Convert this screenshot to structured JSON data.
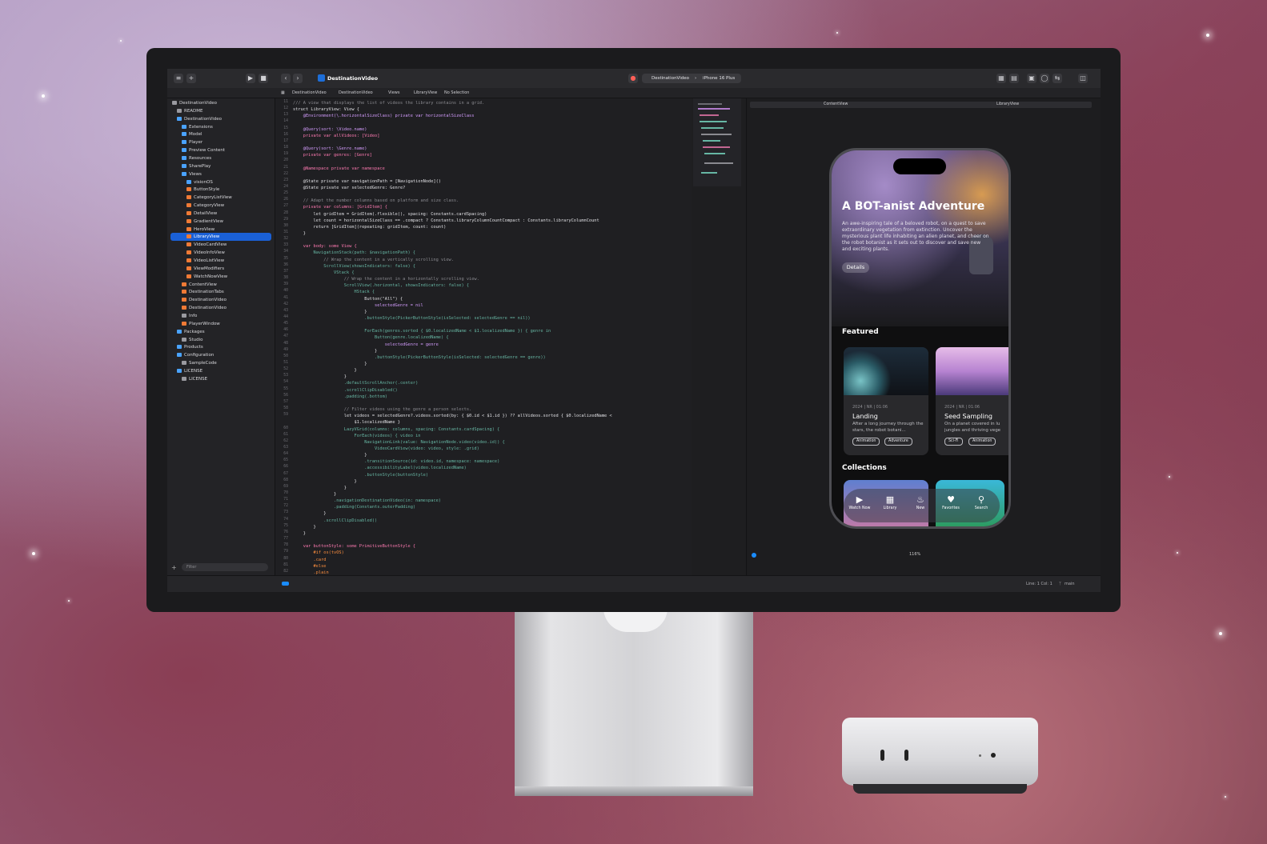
{
  "toolbar": {
    "project_title": "DestinationVideo",
    "scheme_target": "DestinationVideo",
    "scheme_device": "iPhone 16 Plus"
  },
  "jumpbar": {
    "crumbs": [
      "DestinationVideo",
      "DestinationVideo",
      "Views",
      "LibraryView",
      "No Selection"
    ]
  },
  "navigator": {
    "items": [
      {
        "label": "DestinationVideo",
        "icon": "doc",
        "indent": 1
      },
      {
        "label": "README",
        "icon": "doc",
        "indent": 2
      },
      {
        "label": "DestinationVideo",
        "icon": "folder",
        "indent": 2
      },
      {
        "label": "Extensions",
        "icon": "folder",
        "indent": 3
      },
      {
        "label": "Model",
        "icon": "folder",
        "indent": 3
      },
      {
        "label": "Player",
        "icon": "folder",
        "indent": 3
      },
      {
        "label": "Preview Content",
        "icon": "folder",
        "indent": 3
      },
      {
        "label": "Resources",
        "icon": "folder",
        "indent": 3
      },
      {
        "label": "SharePlay",
        "icon": "folder",
        "indent": 3
      },
      {
        "label": "Views",
        "icon": "folder",
        "indent": 3
      },
      {
        "label": "visionOS",
        "icon": "folder",
        "indent": 4
      },
      {
        "label": "ButtonStyle",
        "icon": "swift",
        "indent": 4
      },
      {
        "label": "CategoryListView",
        "icon": "swift",
        "indent": 4
      },
      {
        "label": "CategoryView",
        "icon": "swift",
        "indent": 4
      },
      {
        "label": "DetailView",
        "icon": "swift",
        "indent": 4
      },
      {
        "label": "GradientView",
        "icon": "swift",
        "indent": 4
      },
      {
        "label": "HeroView",
        "icon": "swift",
        "indent": 4
      },
      {
        "label": "LibraryView",
        "icon": "swift",
        "indent": 4,
        "selected": true
      },
      {
        "label": "VideoCardView",
        "icon": "swift",
        "indent": 4
      },
      {
        "label": "VideoInfoView",
        "icon": "swift",
        "indent": 4
      },
      {
        "label": "VideoListView",
        "icon": "swift",
        "indent": 4
      },
      {
        "label": "ViewModifiers",
        "icon": "swift",
        "indent": 4
      },
      {
        "label": "WatchNowView",
        "icon": "swift",
        "indent": 4
      },
      {
        "label": "ContentView",
        "icon": "swift",
        "indent": 3
      },
      {
        "label": "DestinationTabs",
        "icon": "swift",
        "indent": 3
      },
      {
        "label": "DestinationVideo",
        "icon": "swift",
        "indent": 3
      },
      {
        "label": "DestinationVideo",
        "icon": "swift",
        "indent": 3
      },
      {
        "label": "Info",
        "icon": "doc",
        "indent": 3
      },
      {
        "label": "PlayerWindow",
        "icon": "swift",
        "indent": 3
      },
      {
        "label": "Packages",
        "icon": "folder",
        "indent": 2
      },
      {
        "label": "Studio",
        "icon": "doc",
        "indent": 3
      },
      {
        "label": "Products",
        "icon": "folder",
        "indent": 2
      },
      {
        "label": "Configuration",
        "icon": "folder",
        "indent": 2
      },
      {
        "label": "SampleCode",
        "icon": "doc",
        "indent": 3
      },
      {
        "label": "LICENSE",
        "icon": "folder",
        "indent": 2
      },
      {
        "label": "LICENSE",
        "icon": "doc",
        "indent": 3
      }
    ],
    "filter_placeholder": "Filter"
  },
  "editor": {
    "lines": [
      {
        "n": "11",
        "t": "/// A view that displays the list of videos the library contains in a grid.",
        "c": "#8b8b91"
      },
      {
        "n": "12",
        "t": "struct LibraryView: View {",
        "c": "#e0e0e4"
      },
      {
        "n": "13",
        "t": "    @Environment(\\.horizontalSizeClass) private var horizontalSizeClass",
        "c": "#d59dff"
      },
      {
        "n": "14",
        "t": "",
        "c": "#e0e0e4"
      },
      {
        "n": "15",
        "t": "    @Query(sort: \\Video.name)",
        "c": "#d59dff"
      },
      {
        "n": "16",
        "t": "    private var allVideos: [Video]",
        "c": "#ff7ab2"
      },
      {
        "n": "17",
        "t": "",
        "c": "#e0e0e4"
      },
      {
        "n": "18",
        "t": "    @Query(sort: \\Genre.name)",
        "c": "#d59dff"
      },
      {
        "n": "19",
        "t": "    private var genres: [Genre]",
        "c": "#ff7ab2"
      },
      {
        "n": "20",
        "t": "",
        "c": "#e0e0e4"
      },
      {
        "n": "21",
        "t": "    @Namespace private var namespace",
        "c": "#ff7ab2"
      },
      {
        "n": "22",
        "t": "",
        "c": "#e0e0e4"
      },
      {
        "n": "23",
        "t": "    @State private var navigationPath = [NavigationNode]()",
        "c": "#e0e0e4"
      },
      {
        "n": "24",
        "t": "    @State private var selectedGenre: Genre?",
        "c": "#e0e0e4"
      },
      {
        "n": "25",
        "t": "",
        "c": "#e0e0e4"
      },
      {
        "n": "26",
        "t": "    // Adapt the number columns based on platform and size class.",
        "c": "#8b8b91"
      },
      {
        "n": "27",
        "t": "    private var columns: [GridItem] {",
        "c": "#ff7ab2"
      },
      {
        "n": "28",
        "t": "        let gridItem = GridItem(.flexible(), spacing: Constants.cardSpacing)",
        "c": "#e0e0e4"
      },
      {
        "n": "29",
        "t": "        let count = horizontalSizeClass == .compact ? Constants.libraryColumnCountCompact : Constants.libraryColumnCount",
        "c": "#e0e0e4"
      },
      {
        "n": "30",
        "t": "        return [GridItem](repeating: gridItem, count: count)",
        "c": "#e0e0e4"
      },
      {
        "n": "31",
        "t": "    }",
        "c": "#e0e0e4"
      },
      {
        "n": "32",
        "t": "",
        "c": "#e0e0e4"
      },
      {
        "n": "33",
        "t": "    var body: some View {",
        "c": "#ff7ab2"
      },
      {
        "n": "34",
        "t": "        NavigationStack(path: $navigationPath) {",
        "c": "#67b7a4"
      },
      {
        "n": "35",
        "t": "            // Wrap the content in a vertically scrolling view.",
        "c": "#8b8b91"
      },
      {
        "n": "36",
        "t": "            ScrollView(showsIndicators: false) {",
        "c": "#67b7a4"
      },
      {
        "n": "37",
        "t": "                VStack {",
        "c": "#67b7a4"
      },
      {
        "n": "38",
        "t": "                    // Wrap the content in a horizontally scrolling view.",
        "c": "#8b8b91"
      },
      {
        "n": "39",
        "t": "                    ScrollView(.horizontal, showsIndicators: false) {",
        "c": "#67b7a4"
      },
      {
        "n": "40",
        "t": "                        HStack {",
        "c": "#67b7a4"
      },
      {
        "n": "41",
        "t": "                            Button(\"All\") {",
        "c": "#e0e0e4"
      },
      {
        "n": "42",
        "t": "                                selectedGenre = nil",
        "c": "#d59dff"
      },
      {
        "n": "43",
        "t": "                            }",
        "c": "#e0e0e4"
      },
      {
        "n": "44",
        "t": "                            .buttonStyle(PickerButtonStyle(isSelected: selectedGenre == nil))",
        "c": "#67b7a4"
      },
      {
        "n": "45",
        "t": "",
        "c": "#e0e0e4"
      },
      {
        "n": "46",
        "t": "                            ForEach(genres.sorted { $0.localizedName < $1.localizedName }) { genre in",
        "c": "#67b7a4"
      },
      {
        "n": "47",
        "t": "                                Button(genre.localizedName) {",
        "c": "#67b7a4"
      },
      {
        "n": "48",
        "t": "                                    selectedGenre = genre",
        "c": "#d59dff"
      },
      {
        "n": "49",
        "t": "                                }",
        "c": "#e0e0e4"
      },
      {
        "n": "50",
        "t": "                                .buttonStyle(PickerButtonStyle(isSelected: selectedGenre == genre))",
        "c": "#67b7a4"
      },
      {
        "n": "51",
        "t": "                            }",
        "c": "#e0e0e4"
      },
      {
        "n": "52",
        "t": "                        }",
        "c": "#e0e0e4"
      },
      {
        "n": "53",
        "t": "                    }",
        "c": "#e0e0e4"
      },
      {
        "n": "54",
        "t": "                    .defaultScrollAnchor(.center)",
        "c": "#67b7a4"
      },
      {
        "n": "55",
        "t": "                    .scrollClipDisabled()",
        "c": "#67b7a4"
      },
      {
        "n": "56",
        "t": "                    .padding(.bottom)",
        "c": "#67b7a4"
      },
      {
        "n": "57",
        "t": "",
        "c": "#e0e0e4"
      },
      {
        "n": "58",
        "t": "                    // Filter videos using the genre a person selects.",
        "c": "#8b8b91"
      },
      {
        "n": "59",
        "t": "                    let videos = selectedGenre?.videos.sorted(by: { $0.id < $1.id }) ?? allVideos.sorted { $0.localizedName <",
        "c": "#e0e0e4"
      },
      {
        "n": "",
        "t": "                        $1.localizedName }",
        "c": "#e0e0e4"
      },
      {
        "n": "60",
        "t": "                    LazyVGrid(columns: columns, spacing: Constants.cardSpacing) {",
        "c": "#67b7a4"
      },
      {
        "n": "61",
        "t": "                        ForEach(videos) { video in",
        "c": "#67b7a4"
      },
      {
        "n": "62",
        "t": "                            NavigationLink(value: NavigationNode.video(video.id)) {",
        "c": "#67b7a4"
      },
      {
        "n": "63",
        "t": "                                VideoCardView(video: video, style: .grid)",
        "c": "#67b7a4"
      },
      {
        "n": "64",
        "t": "                            }",
        "c": "#e0e0e4"
      },
      {
        "n": "65",
        "t": "                            .transitionSource(id: video.id, namespace: namespace)",
        "c": "#67b7a4"
      },
      {
        "n": "66",
        "t": "                            .accessibilityLabel(video.localizedName)",
        "c": "#67b7a4"
      },
      {
        "n": "67",
        "t": "                            .buttonStyle(buttonStyle)",
        "c": "#67b7a4"
      },
      {
        "n": "68",
        "t": "                        }",
        "c": "#e0e0e4"
      },
      {
        "n": "69",
        "t": "                    }",
        "c": "#e0e0e4"
      },
      {
        "n": "70",
        "t": "                }",
        "c": "#e0e0e4"
      },
      {
        "n": "71",
        "t": "                .navigationDestinationVideo(in: namespace)",
        "c": "#67b7a4"
      },
      {
        "n": "72",
        "t": "                .padding(Constants.outerPadding)",
        "c": "#67b7a4"
      },
      {
        "n": "73",
        "t": "            }",
        "c": "#e0e0e4"
      },
      {
        "n": "74",
        "t": "            .scrollClipDisabled()",
        "c": "#67b7a4"
      },
      {
        "n": "75",
        "t": "        }",
        "c": "#e0e0e4"
      },
      {
        "n": "76",
        "t": "    }",
        "c": "#e0e0e4"
      },
      {
        "n": "77",
        "t": "",
        "c": "#e0e0e4"
      },
      {
        "n": "78",
        "t": "    var buttonStyle: some PrimitiveButtonStyle {",
        "c": "#ff7ab2"
      },
      {
        "n": "79",
        "t": "        #if os(tvOS)",
        "c": "#fd8f3f"
      },
      {
        "n": "80",
        "t": "        .card",
        "c": "#fd8f3f"
      },
      {
        "n": "81",
        "t": "        #else",
        "c": "#fd8f3f"
      },
      {
        "n": "82",
        "t": "        .plain",
        "c": "#fd8f3f"
      }
    ]
  },
  "canvas": {
    "tab_left": "ContentView",
    "tab_right": "LibraryView",
    "zoom": "116%"
  },
  "phone": {
    "hero_title": "A BOT-anist Adventure",
    "hero_desc": "An awe-inspiring tale of a beloved robot, on a quest to save extraordinary vegetation from extinction. Uncover the mysterious plant life inhabiting an alien planet, and cheer on the robot botanist as it sets out to discover and save new and exciting plants.",
    "details_label": "Details",
    "featured_label": "Featured",
    "collections_label": "Collections",
    "cards": [
      {
        "meta": "2024 | NR | 01:06",
        "title": "Landing",
        "desc": "After a long journey through the stars, the robot botani...",
        "tags": [
          "Animation",
          "Adventure"
        ]
      },
      {
        "meta": "2024 | NR | 01:06",
        "title": "Seed Sampling",
        "desc": "On a planet covered in lu jungles and thriving vege",
        "tags": [
          "Sci-Fi",
          "Animation"
        ]
      }
    ],
    "tabs": [
      {
        "label": "Watch Now",
        "icon": "play-icon"
      },
      {
        "label": "Library",
        "icon": "library-icon"
      },
      {
        "label": "New",
        "icon": "bell-icon"
      },
      {
        "label": "Favorites",
        "icon": "heart-icon"
      },
      {
        "label": "Search",
        "icon": "search-icon"
      }
    ]
  },
  "statusbar": {
    "position": "Line: 1  Col: 1",
    "branch": "main"
  },
  "colors": {
    "selection": "#1a60d6",
    "editor_bg": "#1f1f22",
    "keyword": "#ff7ab2",
    "type": "#67b7a4",
    "comment": "#8b8b91"
  }
}
